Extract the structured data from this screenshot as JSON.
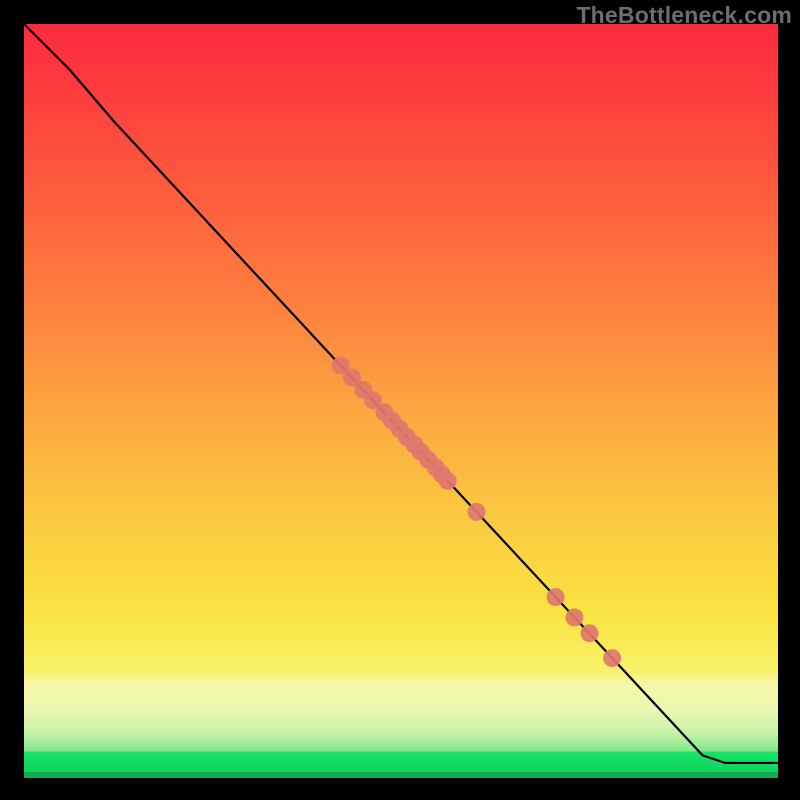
{
  "watermark": "TheBottleneck.com",
  "chart_data": {
    "type": "line",
    "title": "",
    "xlabel": "",
    "ylabel": "",
    "xlim": [
      0,
      100
    ],
    "ylim": [
      0,
      100
    ],
    "grid": false,
    "series": [
      {
        "name": "curve",
        "type": "line",
        "points": [
          {
            "x": 0,
            "y": 100
          },
          {
            "x": 6,
            "y": 94
          },
          {
            "x": 12,
            "y": 87
          },
          {
            "x": 90,
            "y": 3
          },
          {
            "x": 93,
            "y": 2
          },
          {
            "x": 100,
            "y": 2
          }
        ]
      },
      {
        "name": "markers",
        "type": "scatter",
        "points": [
          {
            "x": 42.0,
            "y": 54.7
          },
          {
            "x": 43.5,
            "y": 53.1
          },
          {
            "x": 45.0,
            "y": 51.5
          },
          {
            "x": 46.3,
            "y": 50.1
          },
          {
            "x": 47.8,
            "y": 48.5
          },
          {
            "x": 48.8,
            "y": 47.4
          },
          {
            "x": 49.8,
            "y": 46.3
          },
          {
            "x": 50.8,
            "y": 45.2
          },
          {
            "x": 51.8,
            "y": 44.2
          },
          {
            "x": 52.6,
            "y": 43.3
          },
          {
            "x": 53.6,
            "y": 42.2
          },
          {
            "x": 54.6,
            "y": 41.2
          },
          {
            "x": 55.4,
            "y": 40.3
          },
          {
            "x": 56.2,
            "y": 39.4
          },
          {
            "x": 60.0,
            "y": 35.3
          },
          {
            "x": 70.5,
            "y": 24.0
          },
          {
            "x": 73.0,
            "y": 21.3
          },
          {
            "x": 75.0,
            "y": 19.2
          },
          {
            "x": 78.0,
            "y": 15.9
          }
        ]
      }
    ],
    "background": {
      "type": "vertical-gradient",
      "stops": [
        {
          "pos": 0.0,
          "color": "#fb2a3e"
        },
        {
          "pos": 0.38,
          "color": "#fd823f"
        },
        {
          "pos": 0.66,
          "color": "#fbcb41"
        },
        {
          "pos": 0.86,
          "color": "#f8f26b"
        },
        {
          "pos": 0.94,
          "color": "#c7f3a9"
        },
        {
          "pos": 0.97,
          "color": "#19e36a"
        },
        {
          "pos": 1.0,
          "color": "#0faa52"
        }
      ]
    },
    "curve_color": "#000000",
    "marker_color": "#e0776e",
    "marker_radius": 9
  }
}
